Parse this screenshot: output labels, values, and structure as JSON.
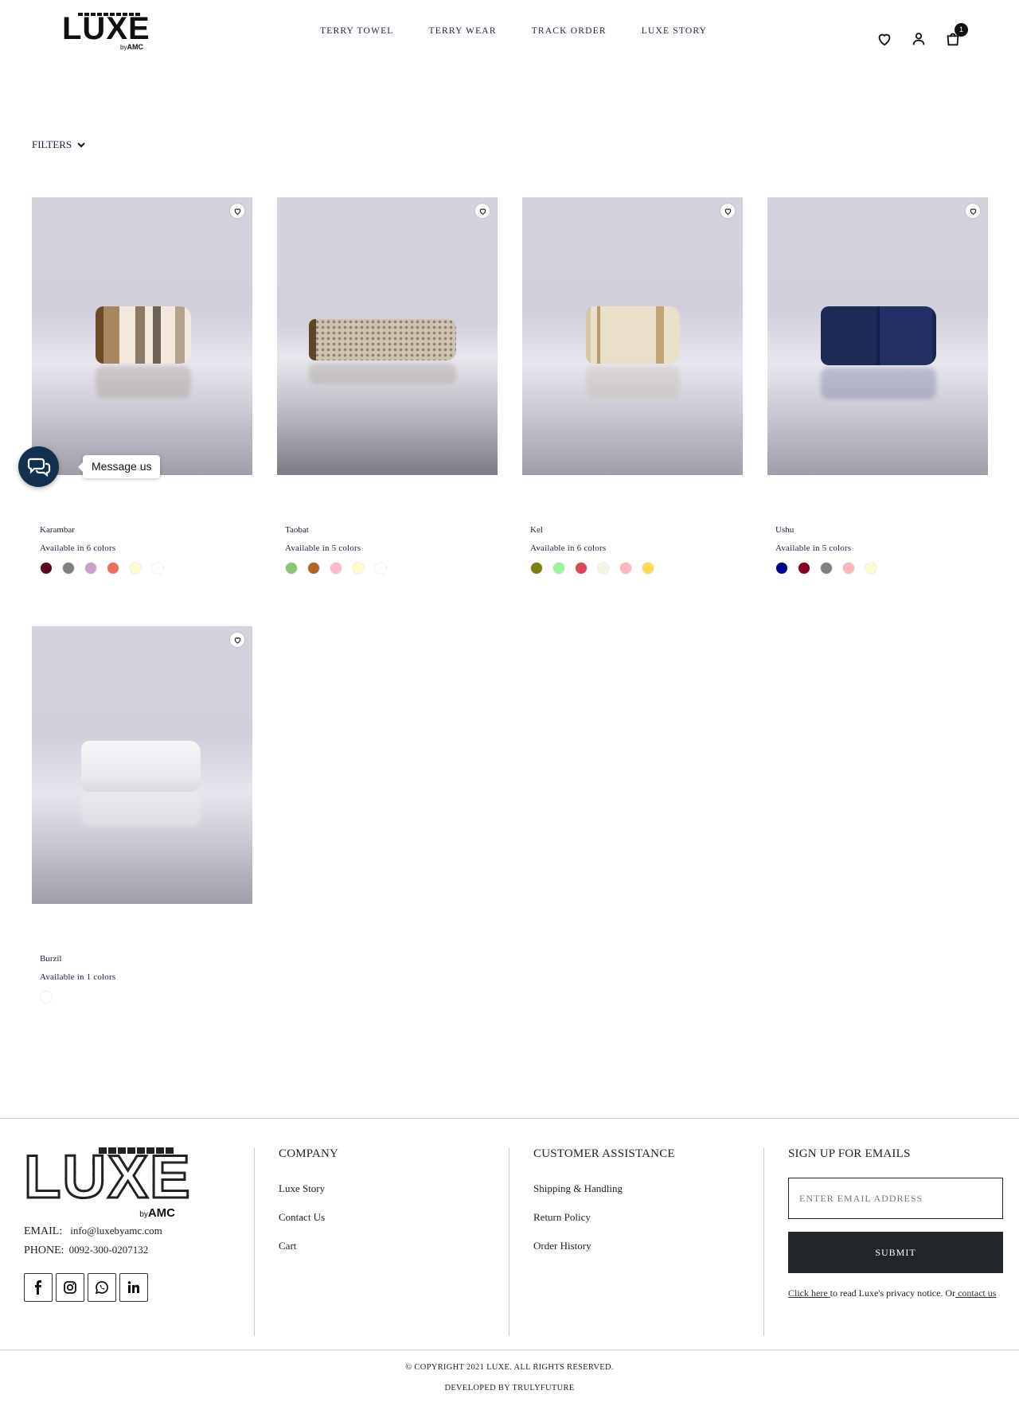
{
  "header": {
    "logo_text": "LUXE",
    "logo_by": "by",
    "logo_brand": "AMC",
    "nav": [
      "TERRY TOWEL",
      "TERRY WEAR",
      "TRACK ORDER",
      "LUXE STORY"
    ],
    "cart_count": "1",
    "icons": [
      "heart-icon",
      "user-icon",
      "cart-icon"
    ]
  },
  "filters": {
    "label": "FILTERS"
  },
  "products": [
    {
      "name": "Karambar",
      "availability": "Available in 6 colors",
      "colors": [
        "#5a0a1e",
        "#808080",
        "#c8a2c8",
        "#e9725e",
        "#fffacd",
        "#ffffff"
      ]
    },
    {
      "name": "Taobat",
      "availability": "Available in 5 colors",
      "colors": [
        "#8cc56f",
        "#b5651d",
        "#f8bbc9",
        "#fffacd",
        "#ffffff"
      ]
    },
    {
      "name": "Kel",
      "availability": "Available in 6 colors",
      "colors": [
        "#808010",
        "#98f598",
        "#dc4558",
        "#f5f5e6",
        "#ffb6c1",
        "#ffd750"
      ]
    },
    {
      "name": "Ushu",
      "availability": "Available in 5 colors",
      "colors": [
        "#00008b",
        "#800020",
        "#808080",
        "#ffb6c1",
        "#fffacd"
      ]
    },
    {
      "name": "Burzil",
      "availability": "Available in 1 colors",
      "colors": [
        "#ffffff"
      ]
    }
  ],
  "message_widget": {
    "label": "Message us"
  },
  "footer": {
    "logo_text": "LUXE",
    "logo_by": "by",
    "logo_brand": "AMC",
    "email_label": "EMAIL:",
    "email": "info@luxebyamc.com",
    "phone_label": "PHONE:",
    "phone": "0092-300-0207132",
    "social_icons": [
      "facebook-icon",
      "instagram-icon",
      "whatsapp-icon",
      "linkedin-icon"
    ],
    "company": {
      "heading": "COMPANY",
      "links": [
        "Luxe Story",
        "Contact Us",
        "Cart"
      ]
    },
    "assistance": {
      "heading": "CUSTOMER ASSISTANCE",
      "links": [
        "Shipping & Handling",
        "Return Policy",
        "Order History"
      ]
    },
    "signup": {
      "heading": "SIGN UP FOR EMAILS",
      "placeholder": "ENTER EMAIL ADDRESS",
      "submit_label": "SUBMIT",
      "privacy_link": "Click here ",
      "privacy_text": "to read Luxe's privacy notice. Or",
      "contact_link": " contact us"
    },
    "copyright": "© COPYRIGHT 2021 LUXE. ALL RIGHTS RESERVED.",
    "developer": "DEVELOPED BY TRULYFUTURE"
  }
}
